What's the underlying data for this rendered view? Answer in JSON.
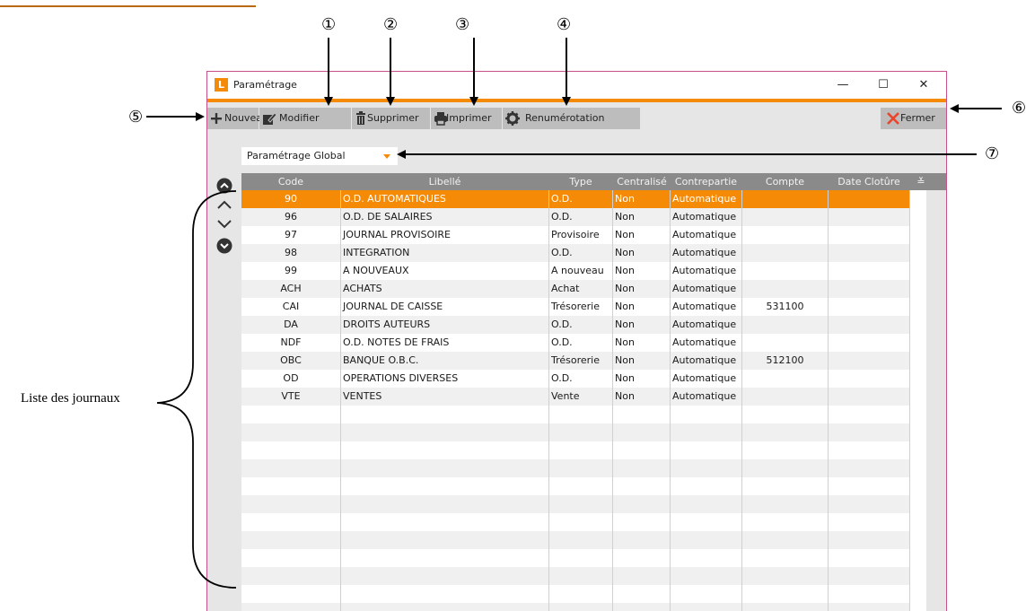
{
  "window": {
    "title": "Paramétrage",
    "logo_letter": "L",
    "minimize": "—",
    "maximize": "☐",
    "close": "✕"
  },
  "toolbar": {
    "nouveau": "Nouveau",
    "modifier": "Modifier",
    "supprimer": "Supprimer",
    "imprimer": "Imprimer",
    "renumerotation": "Renumérotation",
    "fermer": "Fermer"
  },
  "dropdown": {
    "value": "Paramétrage Global"
  },
  "grid": {
    "columns": [
      "Code",
      "Libellé",
      "Type",
      "Centralisé",
      "Contrepartie",
      "Compte",
      "Date Clotûre"
    ],
    "column_menu_glyph": "≚",
    "rows": [
      [
        "90",
        "O.D. AUTOMATIQUES",
        "O.D.",
        "Non",
        "Automatique",
        ""
      ],
      [
        "96",
        "O.D. DE SALAIRES",
        "O.D.",
        "Non",
        "Automatique",
        ""
      ],
      [
        "97",
        "JOURNAL PROVISOIRE",
        "Provisoire",
        "Non",
        "Automatique",
        ""
      ],
      [
        "98",
        "INTEGRATION",
        "O.D.",
        "Non",
        "Automatique",
        ""
      ],
      [
        "99",
        "A NOUVEAUX",
        "A nouveau",
        "Non",
        "Automatique",
        ""
      ],
      [
        "ACH",
        "ACHATS",
        "Achat",
        "Non",
        "Automatique",
        ""
      ],
      [
        "CAI",
        "JOURNAL DE CAISSE",
        "Trésorerie",
        "Non",
        "Automatique",
        "531100"
      ],
      [
        "DA",
        "DROITS AUTEURS",
        "O.D.",
        "Non",
        "Automatique",
        ""
      ],
      [
        "NDF",
        "O.D. NOTES DE FRAIS",
        "O.D.",
        "Non",
        "Automatique",
        ""
      ],
      [
        "OBC",
        "BANQUE O.B.C.",
        "Trésorerie",
        "Non",
        "Automatique",
        "512100"
      ],
      [
        "OD",
        "OPERATIONS DIVERSES",
        "O.D.",
        "Non",
        "Automatique",
        ""
      ],
      [
        "VTE",
        "VENTES",
        "Vente",
        "Non",
        "Automatique",
        ""
      ]
    ],
    "selected_row": 0
  },
  "annotations": {
    "n1": "①",
    "n2": "②",
    "n3": "③",
    "n4": "④",
    "n5": "⑤",
    "n6": "⑥",
    "n7": "⑦",
    "list_label": "Liste des journaux"
  },
  "colors": {
    "accent": "#f58a07",
    "header_bg": "#8a8a8a",
    "window_border": "#c8508a",
    "delete_icon": "#e8452c"
  }
}
